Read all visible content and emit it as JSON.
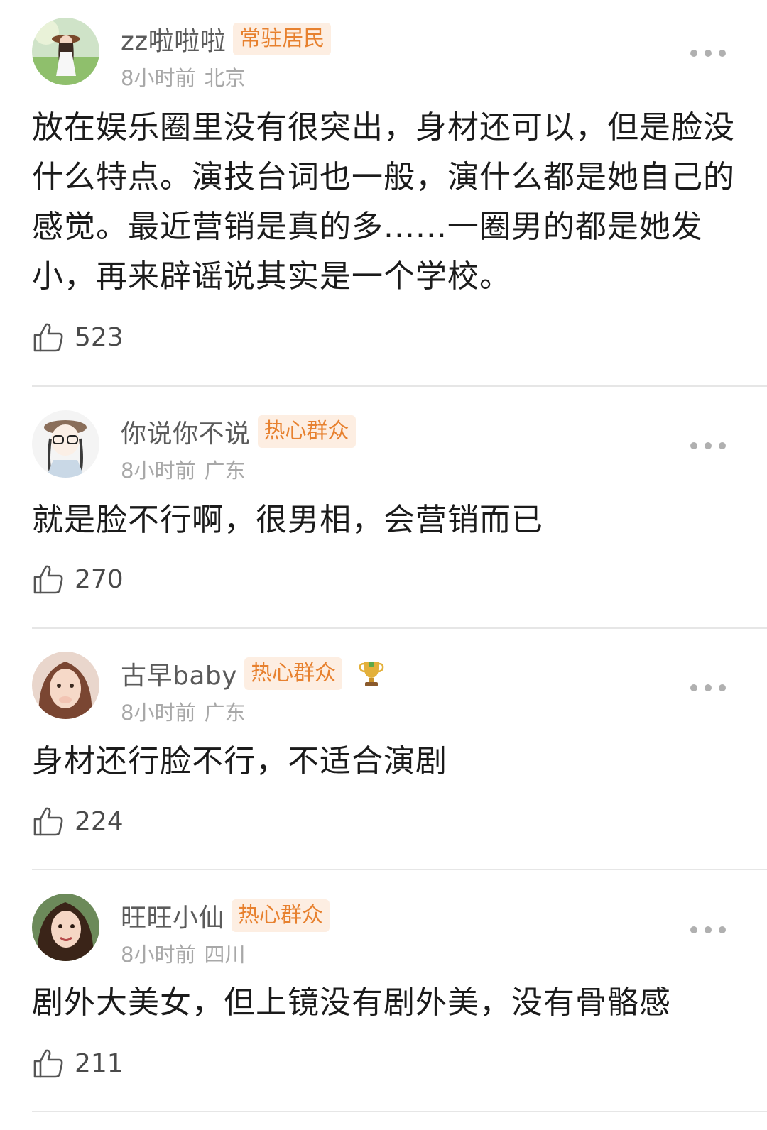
{
  "comments": [
    {
      "username": "zz啦啦啦",
      "badge": "常驻居民",
      "time": "8小时前",
      "location": "北京",
      "text": "放在娱乐圈里没有很突出，身材还可以，但是脸没什么特点。演技台词也一般，演什么都是她自己的感觉。最近营销是真的多......一圈男的都是她发小，再来辟谣说其实是一个学校。",
      "likes": "523"
    },
    {
      "username": "你说你不说",
      "badge": "热心群众",
      "time": "8小时前",
      "location": "广东",
      "text": "就是脸不行啊，很男相，会营销而已",
      "likes": "270"
    },
    {
      "username": "古早baby",
      "badge": "热心群众",
      "time": "8小时前",
      "location": "广东",
      "text": "身材还行脸不行，不适合演剧",
      "likes": "224"
    },
    {
      "username": "旺旺小仙",
      "badge": "热心群众",
      "time": "8小时前",
      "location": "四川",
      "text": "剧外大美女，但上镜没有剧外美，没有骨骼感",
      "likes": "211"
    }
  ],
  "icons": {
    "like": "thumbs-up-icon",
    "more": "more-dots-icon",
    "trophy": "trophy-icon"
  },
  "colors": {
    "badge_bg": "#fdeee2",
    "badge_text": "#e7812f",
    "meta_text": "#a8a8a8",
    "username_text": "#5b5b5b"
  }
}
